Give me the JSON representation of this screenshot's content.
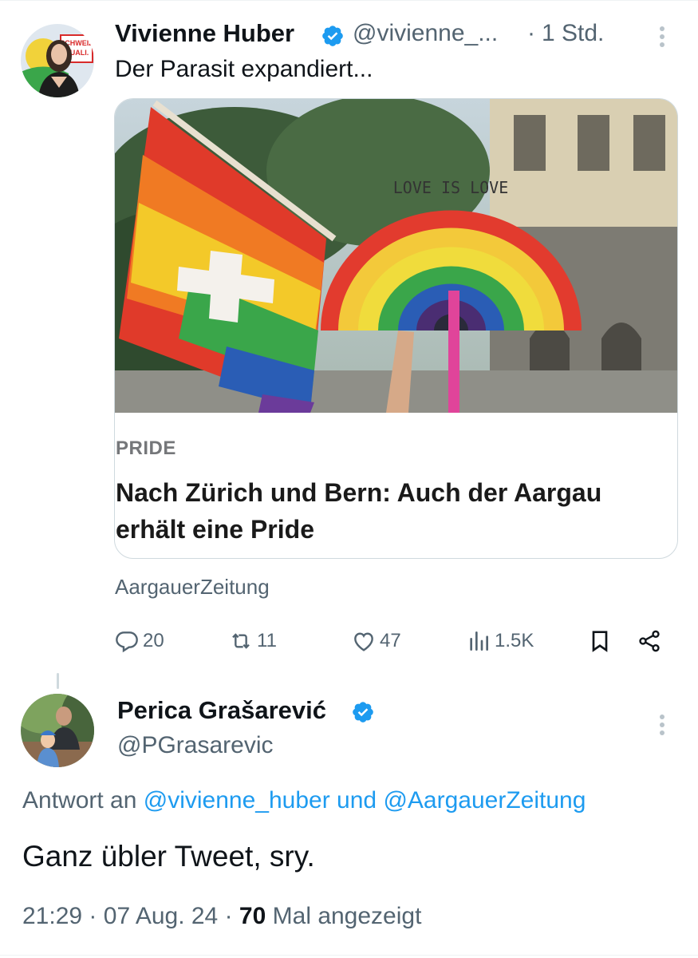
{
  "colors": {
    "accent": "#1d9bf0",
    "secondary_text": "#536471",
    "primary_text": "#0f1419"
  },
  "tweet": {
    "author_name": "Vivienne Huber",
    "author_handle": "@vivienne_...",
    "time_separator": "·",
    "time": "1 Std.",
    "text": "Der Parasit expandiert...",
    "avatar_text": "SCHWEIZ QUALI.",
    "card": {
      "image_sign_text": "LOVE IS LOVE",
      "label": "PRIDE",
      "headline": "Nach Zürich und Bern: Auch der Aargau erhält eine Pride",
      "source": "AargauerZeitung"
    },
    "actions": {
      "replies": "20",
      "retweets": "11",
      "likes": "47",
      "views": "1.5K"
    }
  },
  "reply": {
    "author_name": "Perica Grašarević",
    "author_handle": "@PGrasarevic",
    "reply_to_prefix": "Antwort an",
    "reply_to_user1": "@vivienne_huber",
    "reply_to_join": "und",
    "reply_to_user2": "@AargauerZeitung",
    "text": "Ganz übler Tweet, sry.",
    "time": "21:29",
    "sep1": "·",
    "date": "07 Aug. 24",
    "sep2": "·",
    "view_count": "70",
    "view_label": "Mal angezeigt"
  },
  "icons": {
    "verified": "verified-badge-icon",
    "more": "more-vertical-icon",
    "reply": "reply-icon",
    "retweet": "retweet-icon",
    "like": "heart-icon",
    "views": "bar-chart-icon",
    "bookmark": "bookmark-icon",
    "share": "share-icon"
  }
}
